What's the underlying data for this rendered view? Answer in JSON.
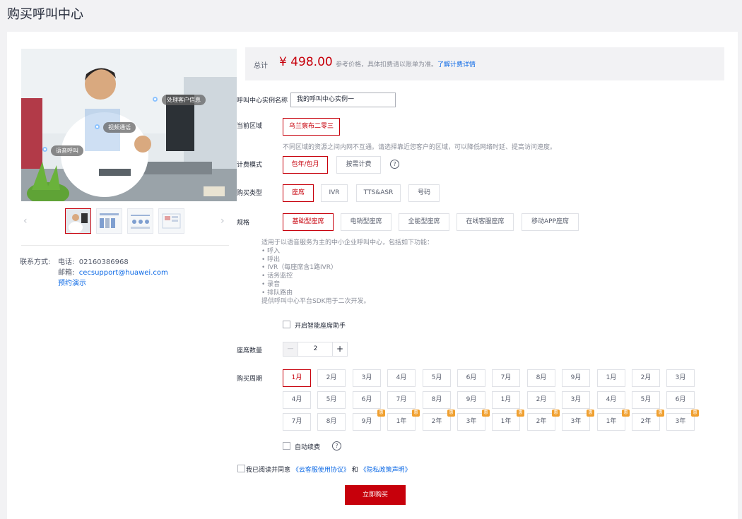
{
  "page": {
    "title": "购买呼叫中心"
  },
  "gallery": {
    "tags": [
      "处理客户信息",
      "视频通话",
      "语音呼叫"
    ],
    "prev_arrow": "‹",
    "next_arrow": "›"
  },
  "contact": {
    "label": "联系方式:",
    "phone_label": "电话:",
    "phone": "02160386968",
    "email_label": "邮箱:",
    "email": "cecsupport@huawei.com",
    "demo_link": "预约演示"
  },
  "total": {
    "label": "总计",
    "price": "¥ 498.00",
    "note": "参考价格，具体扣费请以账单为准。",
    "link": "了解计费详情"
  },
  "form": {
    "instance_name_label": "呼叫中心实例名称",
    "instance_name_value": "我的呼叫中心实例一",
    "region_label": "当前区域",
    "region_value": "乌兰察布二零三",
    "region_note": "不同区域的资源之间内网不互通。请选择靠近您客户的区域，可以降低网络时延、提高访问速度。",
    "billing_label": "计费模式",
    "billing_options": [
      "包年/包月",
      "按需计费"
    ],
    "billing_help": "?",
    "purchase_type_label": "购买类型",
    "purchase_types": [
      "座席",
      "IVR",
      "TTS&ASR",
      "号码"
    ],
    "spec_label": "规格",
    "spec_options": [
      "基础型座席",
      "电销型座席",
      "全能型座席",
      "在线客服座席",
      "移动APP座席"
    ],
    "spec_desc_intro": "适用于以语音服务为主的中小企业呼叫中心，包括如下功能：",
    "spec_features": [
      "•  呼入",
      "•  呼出",
      "•  IVR（每座席含1路IVR）",
      "•  话务监控",
      "•  录音",
      "•  排队路由"
    ],
    "spec_desc_footer": "提供呼叫中心平台SDK用于二次开发。",
    "smart_assistant_label": "开启智能座席助手",
    "seats_label": "座席数量",
    "seats_minus": "—",
    "seats_value": "2",
    "seats_plus": "+",
    "period_label": "购买周期",
    "periods": [
      [
        "1月",
        "2月",
        "3月",
        "4月",
        "5月",
        "6月",
        "7月",
        "8月",
        "9月",
        "1月",
        "2月",
        "3月"
      ],
      [
        "4月",
        "5月",
        "6月",
        "7月",
        "8月",
        "9月",
        "1月",
        "2月",
        "3月",
        "4月",
        "5月",
        "6月"
      ],
      [
        "7月",
        "8月",
        "9月",
        "1年",
        "2年",
        "3年",
        "1年",
        "2年",
        "3年",
        "1年",
        "2年",
        "3年"
      ]
    ],
    "discount_badge": "惠",
    "auto_renew_label": "自动续费",
    "auto_renew_help": "?"
  },
  "agreement": {
    "prefix": "我已阅读并同意",
    "terms_link": "《云客服使用协议》",
    "and": "和",
    "privacy_link": "《隐私政策声明》"
  },
  "buy_button": "立即购买",
  "colors": {
    "accent": "#c7000b",
    "link": "#0f6be6",
    "badge": "#f0a030"
  }
}
